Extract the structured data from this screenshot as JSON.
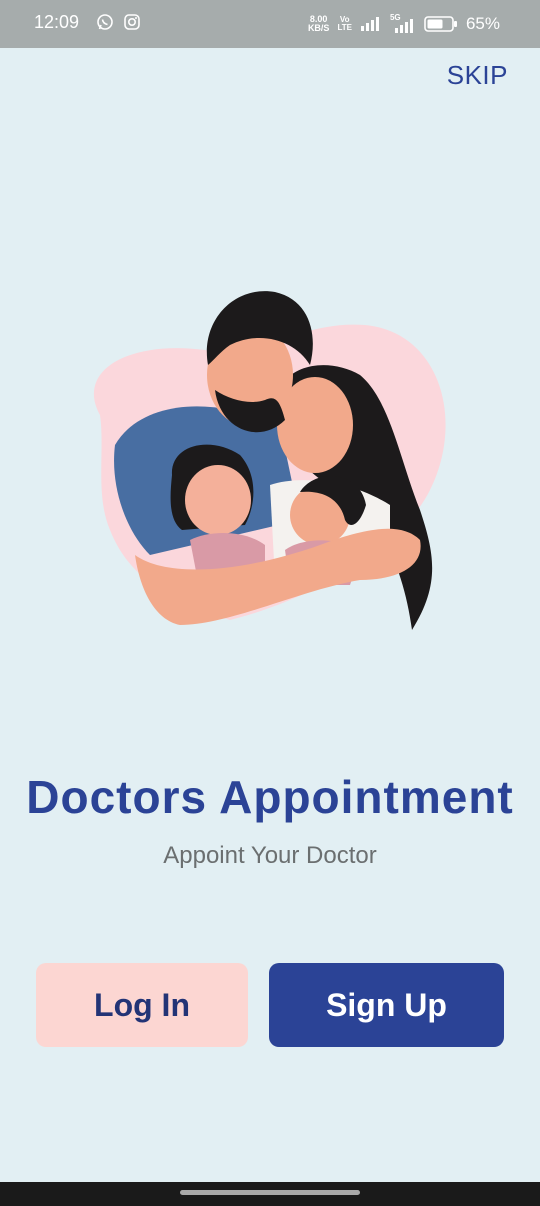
{
  "status_bar": {
    "time": "12:09",
    "net_speed_value": "8.00",
    "net_speed_unit": "KB/S",
    "vowifi_top": "Vo",
    "vowifi_bottom": "LTE",
    "network_5g": "5G",
    "battery_percent": "65%",
    "battery_level": 0.65,
    "icons": [
      "whatsapp-icon",
      "instagram-icon",
      "signal-icon",
      "battery-icon"
    ]
  },
  "header": {
    "skip_label": "SKIP"
  },
  "hero": {
    "illustration": "family-hug-illustration"
  },
  "main": {
    "title": "Doctors Appointment",
    "subtitle": "Appoint Your Doctor"
  },
  "actions": {
    "login_label": "Log In",
    "signup_label": "Sign Up"
  },
  "colors": {
    "background": "#e2eff3",
    "primary": "#2b4396",
    "login_bg": "#fcd6d2",
    "heart": "#fbd7dc"
  }
}
